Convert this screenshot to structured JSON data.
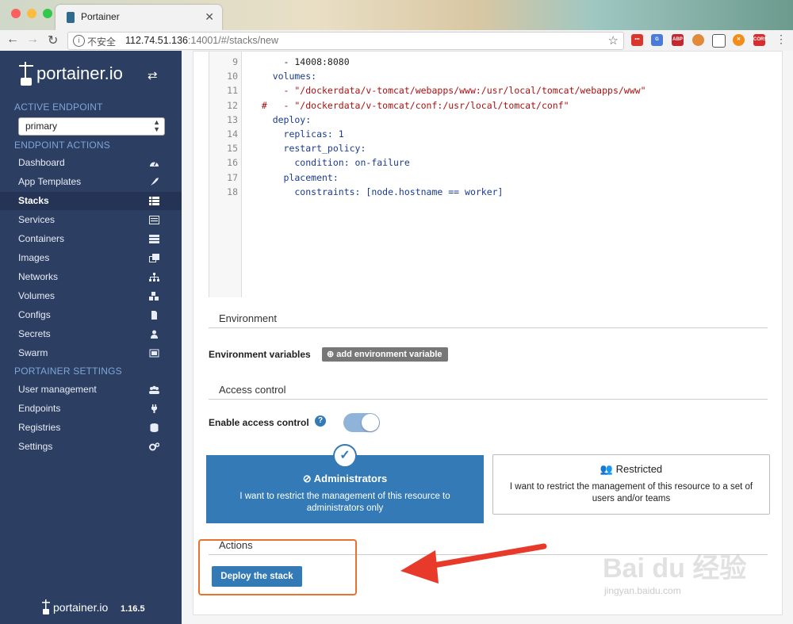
{
  "browser": {
    "tab_title": "Portainer",
    "insecure_label": "不安全",
    "url_host": "112.74.51.136",
    "url_rest": ":14001/#/stacks/new"
  },
  "sidebar": {
    "brand": "portainer.io",
    "active_endpoint_label": "ACTIVE ENDPOINT",
    "endpoint_value": "primary",
    "endpoint_actions_label": "ENDPOINT ACTIONS",
    "items": [
      {
        "label": "Dashboard",
        "icon": "tachometer-icon"
      },
      {
        "label": "App Templates",
        "icon": "rocket-icon"
      },
      {
        "label": "Stacks",
        "icon": "th-list-icon"
      },
      {
        "label": "Services",
        "icon": "list-alt-icon"
      },
      {
        "label": "Containers",
        "icon": "server-icon"
      },
      {
        "label": "Images",
        "icon": "clone-icon"
      },
      {
        "label": "Networks",
        "icon": "sitemap-icon"
      },
      {
        "label": "Volumes",
        "icon": "cubes-icon"
      },
      {
        "label": "Configs",
        "icon": "file-code-icon"
      },
      {
        "label": "Secrets",
        "icon": "user-secret-icon"
      },
      {
        "label": "Swarm",
        "icon": "object-group-icon"
      }
    ],
    "settings_label": "PORTAINER SETTINGS",
    "settings_items": [
      {
        "label": "User management",
        "icon": "users-icon"
      },
      {
        "label": "Endpoints",
        "icon": "plug-icon"
      },
      {
        "label": "Registries",
        "icon": "database-icon"
      },
      {
        "label": "Settings",
        "icon": "cogs-icon"
      }
    ],
    "footer_brand": "portainer.io",
    "version": "1.16.5"
  },
  "editor": {
    "lines": [
      {
        "n": "9",
        "text": "      - 14008:8080"
      },
      {
        "n": "10",
        "text": "    volumes:"
      },
      {
        "n": "11",
        "text": "      - \"/dockerdata/v-tomcat/webapps/www:/usr/local/tomcat/webapps/www\""
      },
      {
        "n": "12",
        "text": "  #   - \"/dockerdata/v-tomcat/conf:/usr/local/tomcat/conf\""
      },
      {
        "n": "13",
        "text": "    deploy:"
      },
      {
        "n": "14",
        "text": "      replicas: 1"
      },
      {
        "n": "15",
        "text": "      restart_policy:"
      },
      {
        "n": "16",
        "text": "        condition: on-failure"
      },
      {
        "n": "17",
        "text": "      placement:"
      },
      {
        "n": "18",
        "text": "        constraints: [node.hostname == worker]"
      }
    ]
  },
  "environment": {
    "header": "Environment",
    "vars_label": "Environment variables",
    "add_button": "add environment variable"
  },
  "access": {
    "header": "Access control",
    "enable_label": "Enable access control",
    "toggle_on": true,
    "admin_title": "Administrators",
    "admin_desc": "I want to restrict the management of this resource to administrators only",
    "restricted_title": "Restricted",
    "restricted_desc": "I want to restrict the management of this resource to a set of users and/or teams"
  },
  "actions": {
    "header": "Actions",
    "deploy_button": "Deploy the stack"
  },
  "watermark": {
    "brand": "Bai  du 经验",
    "sub": "jingyan.baidu.com"
  },
  "colors": {
    "sidebar": "#2d3e63",
    "primary": "#337ab7",
    "annotation": "#e8722e"
  }
}
